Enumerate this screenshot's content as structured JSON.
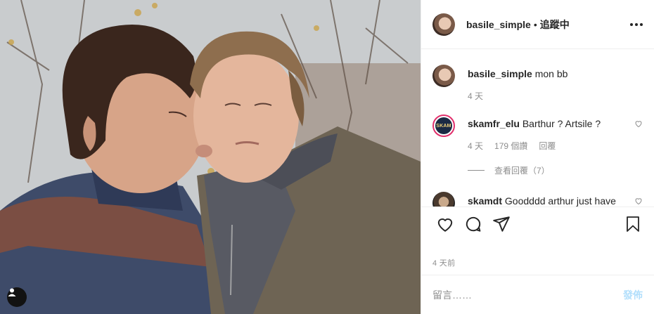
{
  "header": {
    "username": "basile_simple",
    "separator": "•",
    "follow_status": "追蹤中"
  },
  "comments": [
    {
      "username": "basile_simple",
      "text": "mon bb",
      "time": "4 天"
    },
    {
      "username": "skamfr_elu",
      "avatar_text": "SKAM",
      "text": "Barthur ? Artsile ?",
      "time": "4 天",
      "likes": "179 個讚",
      "reply_label": "回覆",
      "view_replies": "查看回覆（7）"
    },
    {
      "username": "skamdt",
      "text": "Goodddd arthur just have"
    }
  ],
  "post_time": "4 天前",
  "add_comment": {
    "placeholder": "留言……",
    "post_label": "發佈"
  },
  "colors": {
    "accent_disabled": "#b2dffc",
    "secondary_text": "#8e8e8e",
    "border": "#efefef"
  },
  "icons": [
    "user-tag-icon",
    "more-options-icon",
    "heart-icon",
    "comment-icon",
    "share-icon",
    "bookmark-icon"
  ]
}
